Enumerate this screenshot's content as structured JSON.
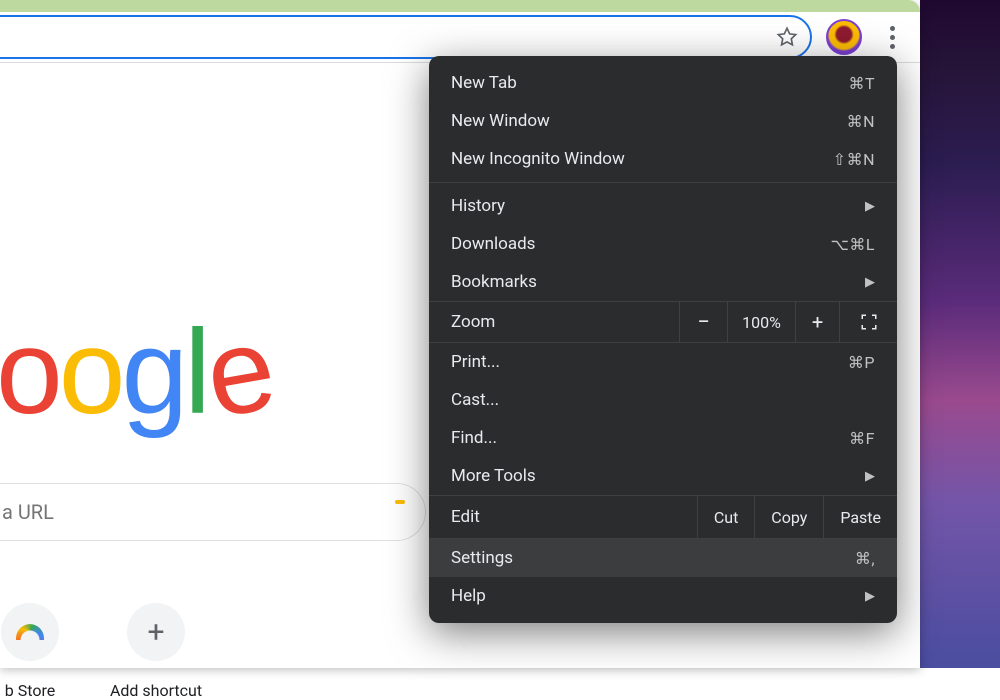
{
  "toolbar": {
    "star_icon": "star-outline",
    "profile_icon": "profile-avatar",
    "menu_icon": "vertical-dots"
  },
  "content": {
    "logo_fragment": "oogle",
    "search_placeholder": "a URL",
    "shortcuts": [
      {
        "label": "b Store",
        "icon": "web-store-icon"
      },
      {
        "label": "Add shortcut",
        "icon": "plus-icon"
      }
    ]
  },
  "menu": {
    "group1": [
      {
        "label": "New Tab",
        "shortcut": "⌘T"
      },
      {
        "label": "New Window",
        "shortcut": "⌘N"
      },
      {
        "label": "New Incognito Window",
        "shortcut": "⇧⌘N"
      }
    ],
    "group2": [
      {
        "label": "History",
        "submenu": true
      },
      {
        "label": "Downloads",
        "shortcut": "⌥⌘L"
      },
      {
        "label": "Bookmarks",
        "submenu": true
      }
    ],
    "zoom": {
      "label": "Zoom",
      "minus": "−",
      "value": "100%",
      "plus": "+"
    },
    "group3": [
      {
        "label": "Print...",
        "shortcut": "⌘P"
      },
      {
        "label": "Cast..."
      },
      {
        "label": "Find...",
        "shortcut": "⌘F"
      },
      {
        "label": "More Tools",
        "submenu": true
      }
    ],
    "edit": {
      "label": "Edit",
      "cut": "Cut",
      "copy": "Copy",
      "paste": "Paste"
    },
    "group4": [
      {
        "label": "Settings",
        "shortcut": "⌘,",
        "highlighted": true
      },
      {
        "label": "Help",
        "submenu": true
      }
    ]
  }
}
